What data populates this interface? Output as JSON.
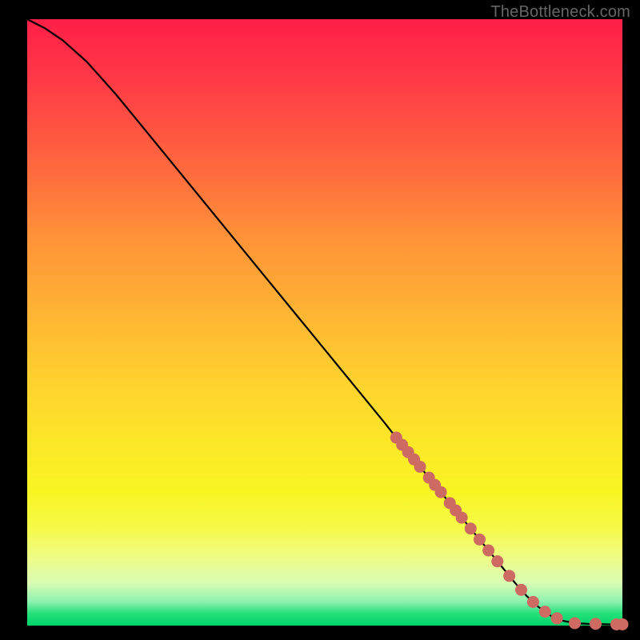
{
  "watermark": "TheBottleneck.com",
  "chart_data": {
    "type": "line",
    "title": "",
    "xlabel": "",
    "ylabel": "",
    "xlim": [
      0,
      100
    ],
    "ylim": [
      0,
      100
    ],
    "grid": false,
    "legend": false,
    "series": [
      {
        "name": "curve",
        "x": [
          0,
          3,
          6,
          10,
          15,
          20,
          25,
          30,
          35,
          40,
          45,
          50,
          55,
          60,
          62,
          64,
          66,
          68,
          70,
          72,
          74,
          76,
          78,
          80,
          82,
          84,
          86,
          88,
          90,
          92,
          94,
          96,
          98,
          100
        ],
        "y": [
          100,
          98.5,
          96.5,
          93,
          87.5,
          81.5,
          75.5,
          69.5,
          63.5,
          57.5,
          51.5,
          45.5,
          39.5,
          33.5,
          31.0,
          28.6,
          26.2,
          23.8,
          21.4,
          19.0,
          16.6,
          14.2,
          11.8,
          9.4,
          7.0,
          4.8,
          3.0,
          1.6,
          0.8,
          0.4,
          0.3,
          0.25,
          0.2,
          0.2
        ]
      }
    ],
    "highlight_points": {
      "x": [
        62,
        63,
        64,
        65,
        66,
        67.5,
        68.5,
        69.5,
        71,
        72,
        73,
        74.5,
        76,
        77.5,
        79,
        81,
        83,
        85,
        87,
        89,
        92,
        95.5,
        99,
        100
      ],
      "y": [
        31.0,
        29.8,
        28.6,
        27.4,
        26.2,
        24.4,
        23.2,
        22.0,
        20.2,
        19.0,
        17.8,
        16.0,
        14.2,
        12.4,
        10.6,
        8.2,
        5.9,
        3.9,
        2.3,
        1.2,
        0.4,
        0.3,
        0.2,
        0.2
      ],
      "radius": 7.5,
      "color": "#cd6a62"
    }
  }
}
